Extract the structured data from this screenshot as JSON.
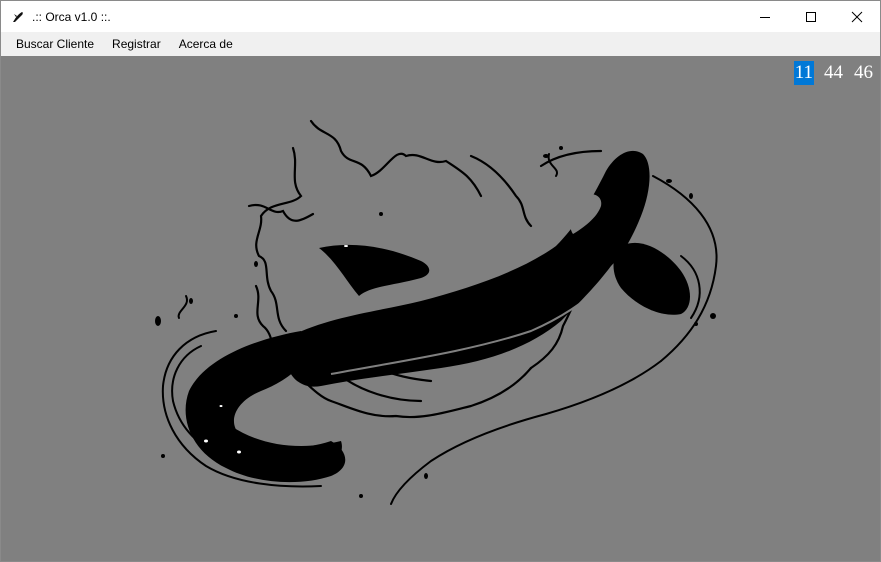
{
  "window": {
    "title": ".:: Orca v1.0 ::.",
    "icon": "orca-icon",
    "controls": [
      "minimize-icon",
      "maximize-icon",
      "close-icon"
    ]
  },
  "menu": {
    "items": [
      "Buscar Cliente",
      "Registrar",
      "Acerca de"
    ]
  },
  "clock": {
    "hours": "11",
    "minutes": "44",
    "seconds": "46",
    "selected": "hours",
    "selection_color": "#0078d7"
  },
  "content": {
    "background_color": "#808080",
    "image": "orca-illustration"
  }
}
